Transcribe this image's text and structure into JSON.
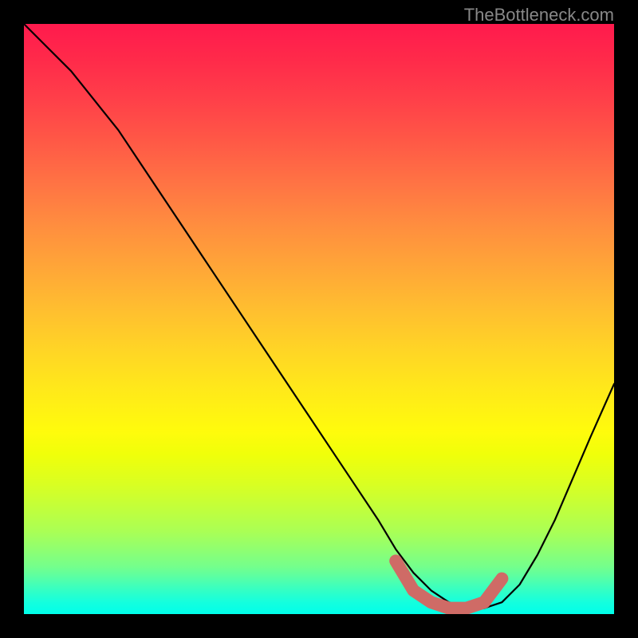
{
  "watermark": "TheBottleneck.com",
  "chart_data": {
    "type": "line",
    "title": "",
    "xlabel": "",
    "ylabel": "",
    "xlim": [
      0,
      100
    ],
    "ylim": [
      0,
      100
    ],
    "grid": false,
    "legend": false,
    "background_gradient": {
      "top_color": "#ff1a4d",
      "bottom_color": "#00ffea",
      "description": "vertical heat gradient red-yellow-green-cyan"
    },
    "series": [
      {
        "name": "bottleneck-curve",
        "color": "#000000",
        "x": [
          0,
          4,
          8,
          12,
          16,
          20,
          24,
          28,
          32,
          36,
          40,
          44,
          48,
          52,
          56,
          60,
          63,
          66,
          69,
          72,
          75,
          78,
          81,
          84,
          87,
          90,
          93,
          96,
          100
        ],
        "y": [
          100,
          96,
          92,
          87,
          82,
          76,
          70,
          64,
          58,
          52,
          46,
          40,
          34,
          28,
          22,
          16,
          11,
          7,
          4,
          2,
          1,
          1,
          2,
          5,
          10,
          16,
          23,
          30,
          39
        ]
      },
      {
        "name": "highlight-minimum",
        "color": "#cf6b66",
        "x": [
          63,
          66,
          69,
          72,
          75,
          78,
          81
        ],
        "y": [
          9,
          4,
          2,
          1,
          1,
          2,
          6
        ]
      }
    ],
    "annotations": []
  }
}
